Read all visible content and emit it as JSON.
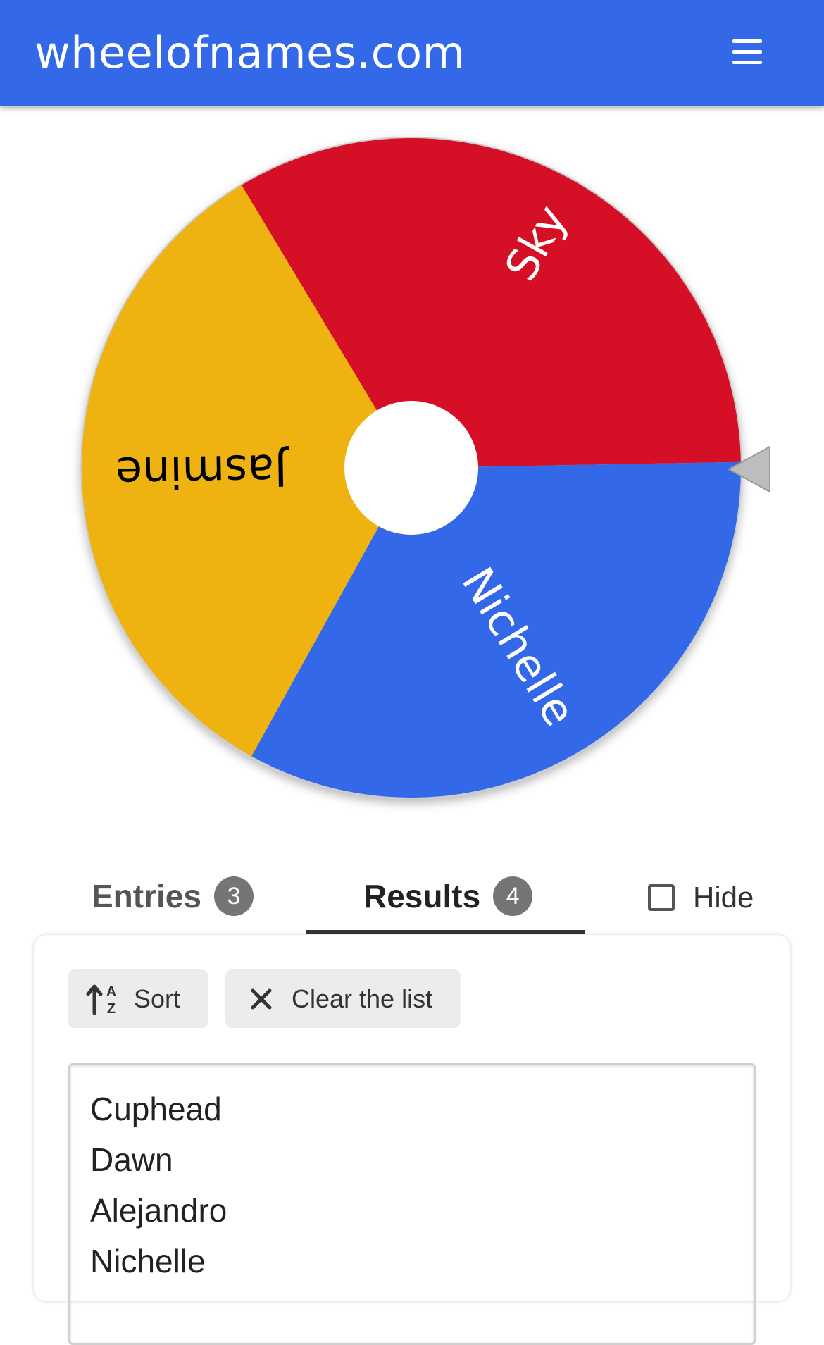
{
  "header": {
    "site_title": "wheelofnames.com",
    "menu_icon": "hamburger-menu-icon",
    "background_color": "#3369e8"
  },
  "wheel": {
    "segments": [
      {
        "label": "Sky",
        "color": "#d50f25"
      },
      {
        "label": "Nichelle",
        "color": "#3369e8"
      },
      {
        "label": "Jasmine",
        "color": "#eeb211"
      }
    ],
    "center_color": "#ffffff",
    "pointer_icon": "pointer-triangle-icon",
    "pointer_color": "#bdbdbd"
  },
  "tabs": {
    "entries": {
      "label": "Entries",
      "count": "3"
    },
    "results": {
      "label": "Results",
      "count": "4"
    },
    "active": "results"
  },
  "hide": {
    "label": "Hide",
    "checked": false
  },
  "toolbar": {
    "sort_label": "Sort",
    "sort_icon": "sort-alpha-icon",
    "clear_label": "Clear the list",
    "clear_icon": "close-icon"
  },
  "results": [
    "Cuphead",
    "Dawn",
    "Alejandro",
    "Nichelle"
  ]
}
